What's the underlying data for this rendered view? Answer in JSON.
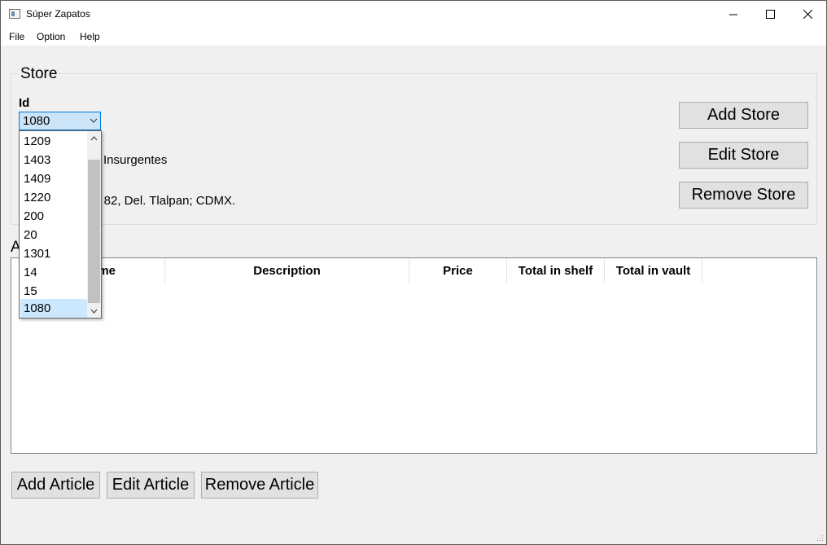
{
  "window": {
    "title": "Súper Zapatos"
  },
  "menu": [
    "File",
    "Option",
    "Help"
  ],
  "store": {
    "group_title": "Store",
    "id_label": "Id",
    "id_value": "1080",
    "name_fragment": "Insurgentes",
    "address_fragment": "s 82, Del. Tlalpan; CDMX.",
    "buttons": {
      "add": "Add Store",
      "edit": "Edit Store",
      "remove": "Remove Store"
    }
  },
  "dropdown": {
    "options": [
      "1209",
      "1403",
      "1409",
      "1220",
      "200",
      "20",
      "1301",
      "14",
      "15",
      "1080"
    ],
    "selected": "1080"
  },
  "articles": {
    "label_fragment": "A",
    "columns": [
      "ame",
      "Description",
      "Price",
      "Total in shelf",
      "Total in vault"
    ],
    "buttons": {
      "add": "Add Article",
      "edit": "Edit Article",
      "remove": "Remove Article"
    }
  },
  "icons": {
    "app": "app-window-icon",
    "minimize": "minimize-icon",
    "maximize": "maximize-icon",
    "close": "close-icon",
    "combo_arrow": "chevron-down-icon",
    "scroll_up": "chevron-up-icon",
    "scroll_down": "chevron-down-icon",
    "grip": "resize-grip-icon"
  },
  "colors": {
    "selection": "#cce8ff",
    "focus_border": "#0078d7",
    "button_bg": "#e1e1e1"
  }
}
